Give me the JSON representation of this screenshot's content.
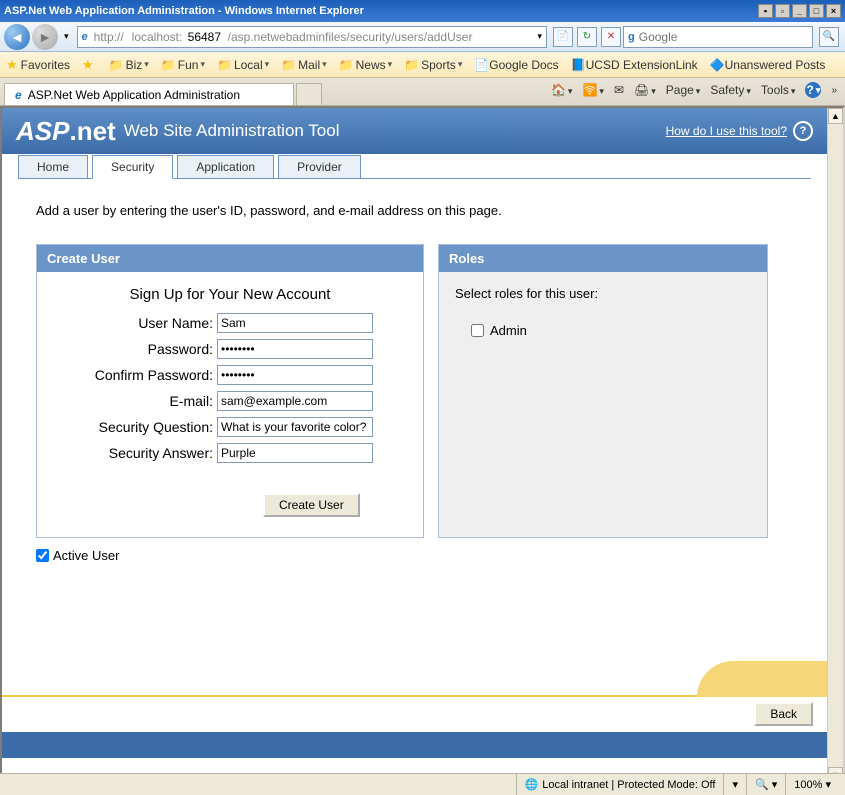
{
  "window": {
    "title": "ASP.Net Web Application Administration - Windows Internet Explorer"
  },
  "address": {
    "protocol": "http://",
    "host": "localhost:",
    "port": "56487",
    "path": "/asp.netwebadminfiles/security/users/addUser"
  },
  "search": {
    "placeholder": "Google"
  },
  "favorites": {
    "label": "Favorites",
    "items": [
      "Biz",
      "Fun",
      "Local",
      "Mail",
      "News",
      "Sports"
    ],
    "links": [
      "Google Docs",
      "UCSD ExtensionLink",
      "Unanswered Posts"
    ]
  },
  "pagetab": {
    "title": "ASP.Net Web Application Administration"
  },
  "cmdbar": {
    "page": "Page",
    "safety": "Safety",
    "tools": "Tools"
  },
  "header": {
    "logo_left": "ASP",
    "logo_right": ".net",
    "title": "Web Site Administration Tool",
    "help": "How do I use this tool?"
  },
  "tabs": [
    "Home",
    "Security",
    "Application",
    "Provider"
  ],
  "active_tab": "Security",
  "instruction": "Add a user by entering the user's ID, password, and e-mail address on this page.",
  "create_user": {
    "panel_title": "Create User",
    "signup_title": "Sign Up for Your New Account",
    "fields": {
      "username_label": "User Name:",
      "username_value": "Sam",
      "password_label": "Password:",
      "password_value": "••••••••",
      "confirm_label": "Confirm Password:",
      "confirm_value": "••••••••",
      "email_label": "E-mail:",
      "email_value": "sam@example.com",
      "question_label": "Security Question:",
      "question_value": "What is your favorite color?",
      "answer_label": "Security Answer:",
      "answer_value": "Purple"
    },
    "button": "Create User",
    "active_user_label": "Active User"
  },
  "roles": {
    "panel_title": "Roles",
    "instruction": "Select roles for this user:",
    "items": [
      "Admin"
    ]
  },
  "back_button": "Back",
  "status": {
    "zone": "Local intranet | Protected Mode: Off",
    "zoom": "100%"
  }
}
